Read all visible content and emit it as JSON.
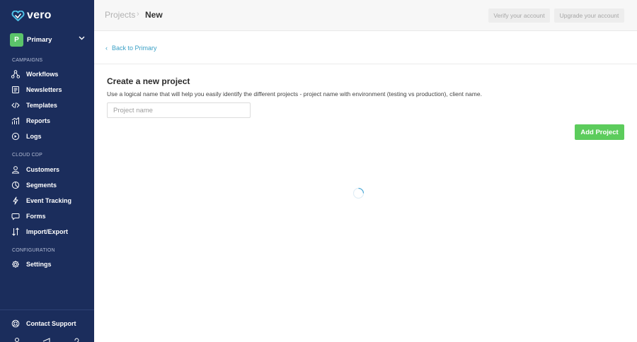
{
  "app": {
    "brand": "vero"
  },
  "workspace": {
    "initial": "P",
    "name": "Primary"
  },
  "sidebar": {
    "sections": [
      {
        "label": "CAMPAIGNS"
      },
      {
        "label": "CLOUD CDP"
      },
      {
        "label": "CONFIGURATION"
      }
    ],
    "items": [
      {
        "label": "Workflows",
        "icon": "workflows-icon"
      },
      {
        "label": "Newsletters",
        "icon": "newsletters-icon"
      },
      {
        "label": "Templates",
        "icon": "code-icon"
      },
      {
        "label": "Reports",
        "icon": "chart-icon"
      },
      {
        "label": "Logs",
        "icon": "logs-icon"
      },
      {
        "label": "Customers",
        "icon": "user-icon"
      },
      {
        "label": "Segments",
        "icon": "pie-icon"
      },
      {
        "label": "Event Tracking",
        "icon": "bolt-icon"
      },
      {
        "label": "Forms",
        "icon": "chat-icon"
      },
      {
        "label": "Import/Export",
        "icon": "import-export-icon"
      },
      {
        "label": "Settings",
        "icon": "gear-icon"
      }
    ],
    "support_label": "Contact Support"
  },
  "header": {
    "breadcrumb_parent": "Projects",
    "breadcrumb_separator": "›",
    "breadcrumb_current": "New",
    "verify_label": "Verify your account",
    "upgrade_label": "Upgrade your account"
  },
  "main": {
    "back_chevron": "‹",
    "back_label": "Back to Primary",
    "title": "Create a new project",
    "description": "Use a logical name that will help you easily identify the different projects - project name with environment (testing vs production), client name.",
    "input_placeholder": "Project name",
    "input_value": "",
    "add_label": "Add Project"
  },
  "colors": {
    "sidebar_bg": "#1b2d5c",
    "accent_green": "#5ccc5c",
    "link_blue": "#3aa0c6",
    "logo_blue": "#4fc3e8"
  }
}
